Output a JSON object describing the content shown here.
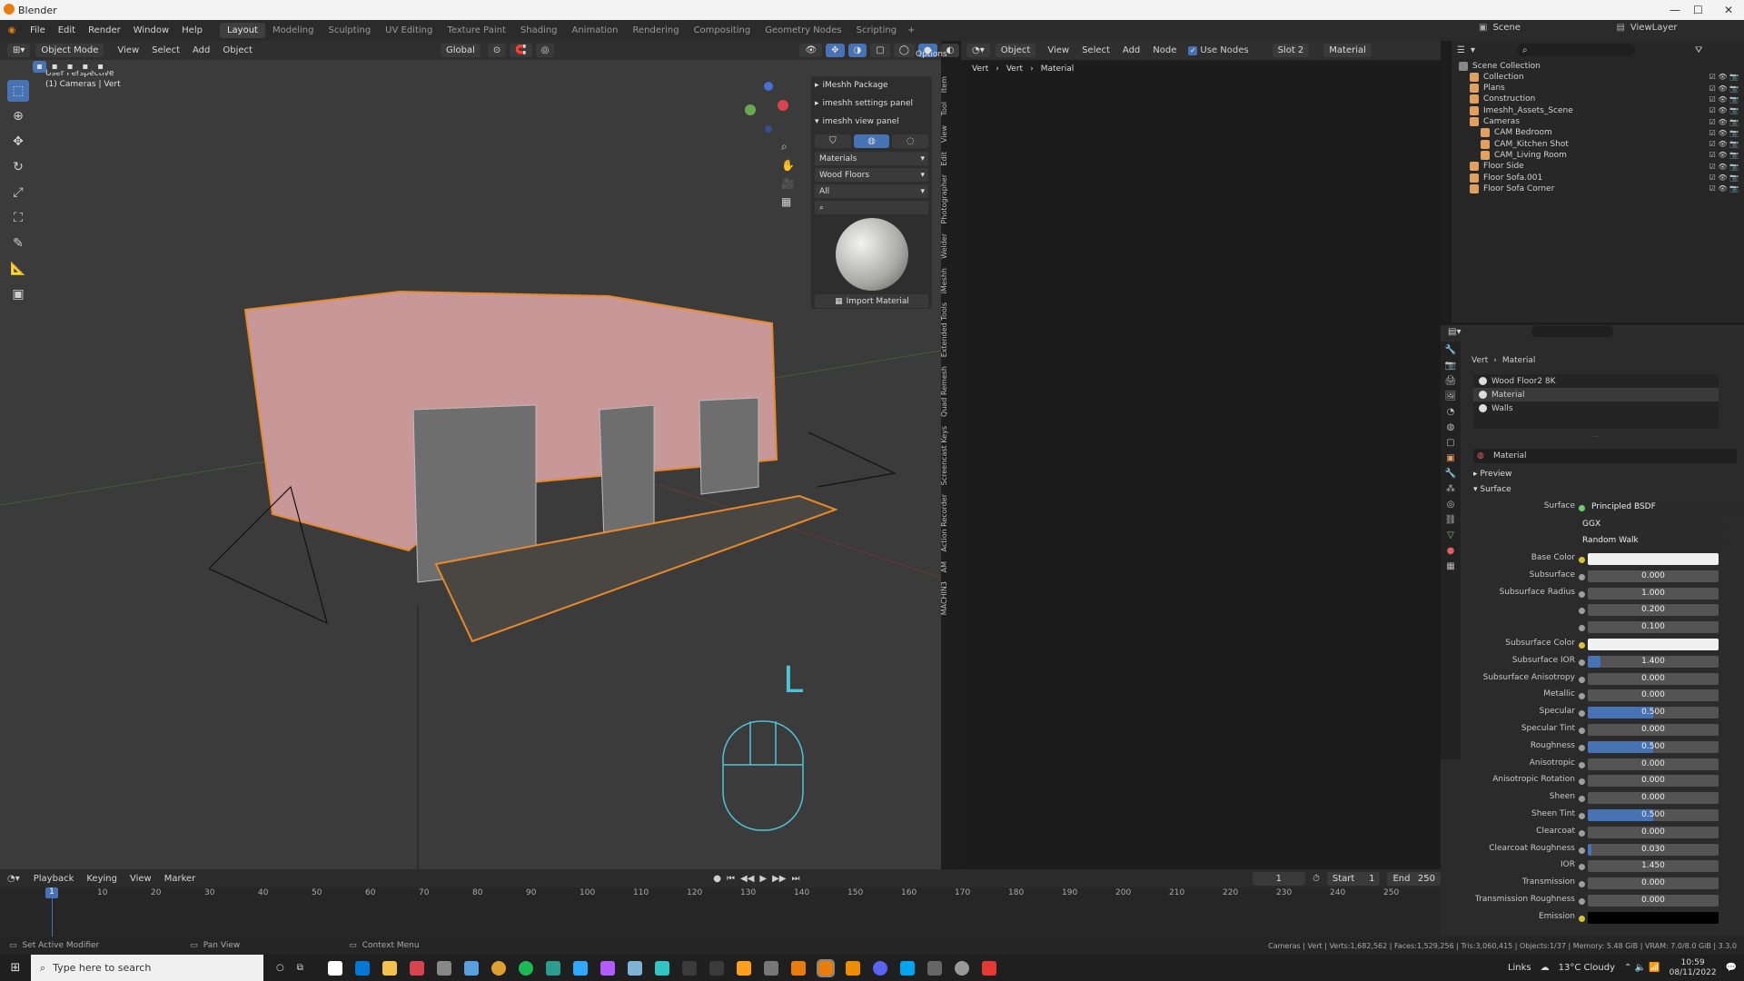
{
  "window": {
    "title": "Blender"
  },
  "menus": [
    "File",
    "Edit",
    "Render",
    "Window",
    "Help"
  ],
  "workspaces": [
    {
      "label": "Layout",
      "active": true
    },
    {
      "label": "Modeling"
    },
    {
      "label": "Sculpting"
    },
    {
      "label": "UV Editing"
    },
    {
      "label": "Texture Paint"
    },
    {
      "label": "Shading"
    },
    {
      "label": "Animation"
    },
    {
      "label": "Rendering"
    },
    {
      "label": "Compositing"
    },
    {
      "label": "Geometry Nodes"
    },
    {
      "label": "Scripting"
    }
  ],
  "scene": "Scene",
  "viewlayer": "ViewLayer",
  "viewport": {
    "mode": "Object Mode",
    "menu": [
      "View",
      "Select",
      "Add",
      "Object"
    ],
    "transform": "Global",
    "options": "Options",
    "info1": "User Perspective",
    "info2": "(1) Cameras | Vert",
    "key_overlay": "L"
  },
  "npanel": {
    "items": [
      "iMeshh Package",
      "imeshh settings panel",
      "imeshh view panel"
    ],
    "dd1": "Materials",
    "dd2": "Wood Floors",
    "dd3": "All",
    "import_btn": "Import Material"
  },
  "vtabs": [
    "Item",
    "Tool",
    "View",
    "Edit",
    "Photographer",
    "Welder",
    "iMeshh",
    "Extended Tools",
    "Quad Remesh",
    "Screencast Keys",
    "Action Recorder",
    "AM",
    "MACHIN3"
  ],
  "node_editor": {
    "mode": "Object",
    "menu": [
      "View",
      "Select",
      "Add",
      "Node"
    ],
    "use_nodes": "Use Nodes",
    "slot": "Slot 2",
    "material": "Material",
    "breadcrumb": [
      "Vert",
      "Vert",
      "Material"
    ]
  },
  "outliner": {
    "rows": [
      {
        "label": "Scene Collection",
        "indent": 0,
        "color": "#c8c8c8"
      },
      {
        "label": "Collection",
        "indent": 1,
        "color": "#e0a060"
      },
      {
        "label": "Plans",
        "indent": 1,
        "color": "#e0a060"
      },
      {
        "label": "Construction",
        "indent": 1,
        "color": "#e0a060"
      },
      {
        "label": "Imeshh_Assets_Scene",
        "indent": 1,
        "color": "#e0a060"
      },
      {
        "label": "Cameras",
        "indent": 1,
        "color": "#e0a060"
      },
      {
        "label": "CAM Bedroom",
        "indent": 2,
        "color": "#e0a060"
      },
      {
        "label": "CAM_Kitchen Shot",
        "indent": 2,
        "color": "#e0a060"
      },
      {
        "label": "CAM_Living Room",
        "indent": 2,
        "color": "#e0a060"
      },
      {
        "label": "Floor Side",
        "indent": 1,
        "color": "#e0a060"
      },
      {
        "label": "Floor Sofa.001",
        "indent": 1,
        "color": "#e0a060"
      },
      {
        "label": "Floor Sofa Corner",
        "indent": 1,
        "color": "#e0a060"
      }
    ]
  },
  "properties": {
    "breadcrumb": [
      "Vert",
      "Material"
    ],
    "slots": [
      "Wood Floor2 8K",
      "Material",
      "Walls"
    ],
    "material_name": "Material",
    "sections": [
      "Preview",
      "Surface"
    ],
    "surface_label": "Surface",
    "surface_value": "Principled BSDF",
    "distribution": "GGX",
    "subsurface_method": "Random Walk",
    "params": [
      {
        "label": "Base Color",
        "value": "",
        "color": "#f0f0f0"
      },
      {
        "label": "Subsurface",
        "value": "0.000"
      },
      {
        "label": "Subsurface Radius",
        "value": "1.000"
      },
      {
        "label": "",
        "value": "0.200"
      },
      {
        "label": "",
        "value": "0.100"
      },
      {
        "label": "Subsurface Color",
        "value": "",
        "color": "#f0f0f0"
      },
      {
        "label": "Subsurface IOR",
        "value": "1.400",
        "fill": 0.1
      },
      {
        "label": "Subsurface Anisotropy",
        "value": "0.000"
      },
      {
        "label": "Metallic",
        "value": "0.000"
      },
      {
        "label": "Specular",
        "value": "0.500",
        "fill": 0.5
      },
      {
        "label": "Specular Tint",
        "value": "0.000"
      },
      {
        "label": "Roughness",
        "value": "0.500",
        "fill": 0.5
      },
      {
        "label": "Anisotropic",
        "value": "0.000"
      },
      {
        "label": "Anisotropic Rotation",
        "value": "0.000"
      },
      {
        "label": "Sheen",
        "value": "0.000"
      },
      {
        "label": "Sheen Tint",
        "value": "0.500",
        "fill": 0.5
      },
      {
        "label": "Clearcoat",
        "value": "0.000"
      },
      {
        "label": "Clearcoat Roughness",
        "value": "0.030",
        "fill": 0.03
      },
      {
        "label": "IOR",
        "value": "1.450"
      },
      {
        "label": "Transmission",
        "value": "0.000"
      },
      {
        "label": "Transmission Roughness",
        "value": "0.000"
      },
      {
        "label": "Emission",
        "value": "",
        "color": "#000000"
      }
    ]
  },
  "timeline": {
    "menu": [
      "Playback",
      "Keying",
      "View",
      "Marker"
    ],
    "current": "1",
    "start_label": "Start",
    "start": "1",
    "end_label": "End",
    "end": "250",
    "ticks": [
      "10",
      "20",
      "30",
      "40",
      "50",
      "60",
      "70",
      "80",
      "90",
      "100",
      "110",
      "120",
      "130",
      "140",
      "150",
      "160",
      "170",
      "180",
      "190",
      "200",
      "210",
      "220",
      "230",
      "240",
      "250"
    ],
    "marker": "1"
  },
  "status": {
    "left": "Set Active Modifier",
    "mid": "Pan View",
    "ctx": "Context Menu",
    "right": "Cameras | Vert | Verts:1,682,562 | Faces:1,529,256 | Tris:3,060,415 | Objects:1/37 | Memory: 5.48 GiB | VRAM: 7.0/8.0 GiB | 3.3.0"
  },
  "taskbar": {
    "search": "Type here to search",
    "links": "Links",
    "weather": "13°C Cloudy",
    "time": "10:59",
    "date": "08/11/2022"
  }
}
